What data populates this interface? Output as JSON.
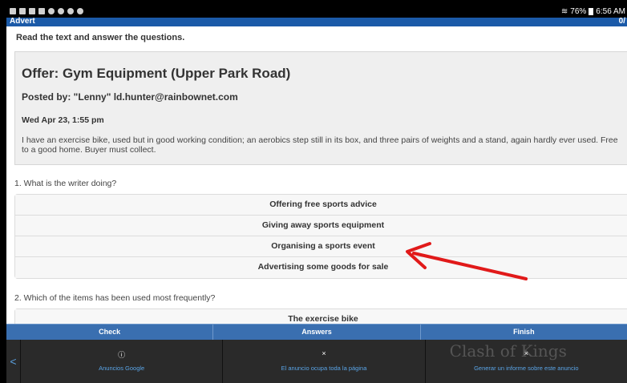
{
  "status_bar": {
    "battery": "76%",
    "time": "6:56 AM",
    "icons": [
      "photo-icon",
      "image-icon",
      "gallery-icon",
      "mail-icon",
      "android-icon",
      "android-icon",
      "android-icon",
      "android-icon"
    ]
  },
  "title_bar": {
    "title": "Advert",
    "progress": "0/"
  },
  "instruction": "Read the text and answer the questions.",
  "advert": {
    "title": "Offer: Gym Equipment (Upper Park Road)",
    "posted_by": "Posted by: \"Lenny\" ld.hunter@rainbownet.com",
    "date": "Wed Apr 23,  1:55 pm",
    "body": "I have an exercise bike, used but in good working condition; an aerobics step still in its box, and three pairs of weights and a stand, again hardly ever used. Free to a good home.  Buyer must collect."
  },
  "questions": [
    {
      "label": "1. What is the writer doing?",
      "options": [
        "Offering free sports advice",
        "Giving away sports equipment",
        "Organising a sports event",
        "Advertising some goods for sale"
      ]
    },
    {
      "label": "2. Which of the items has been used most frequently?",
      "options": [
        "The exercise bike"
      ]
    }
  ],
  "action_bar": {
    "check": "Check",
    "answers": "Answers",
    "finish": "Finish"
  },
  "ad_bar": {
    "chevron": "<",
    "google_icon": "ⓘ",
    "google_label": "Anuncios Google",
    "fullpage_icon": "×",
    "fullpage_label": "El anuncio ocupa toda la página",
    "report_icon": "×",
    "report_label": "Generar un informe sobre este anuncio",
    "game_text": "Clash of Kings"
  },
  "colors": {
    "title_bar": "#1b5aa8",
    "action_bar": "#3a6fb0",
    "arrow": "#e11a1a",
    "ad_text": "#5aa5e8"
  }
}
